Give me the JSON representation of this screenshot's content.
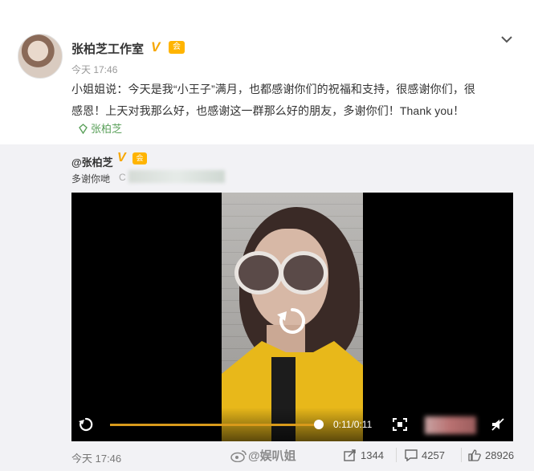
{
  "post": {
    "author": "张柏芝工作室",
    "verified_badge": "V",
    "vip_badge": "会",
    "time": "今天 17:46",
    "text_line1": "小姐姐说：今天是我“小王子”满月，也都感谢你们的祝福和支持，很感谢你们，很",
    "text_line2": "感恩！上天对我那么好，也感谢这一群那么好的朋友，多谢你们！Thank you！",
    "topic": "张柏芝"
  },
  "repost": {
    "author": "@张柏芝",
    "verified_badge": "V",
    "vip_badge": "会",
    "text": "多谢你哋",
    "link_prefix": "C"
  },
  "video": {
    "time": "0:11/0:11",
    "progress": 1.0
  },
  "footer": {
    "time": "今天 17:46",
    "watermark": "@娱叭姐",
    "reposts": "1344",
    "comments": "4257",
    "likes": "28926"
  },
  "colors": {
    "accent": "#f7a700",
    "topic": "#5aa05a",
    "progress": "#d99a1b"
  },
  "icons": [
    "chevron-down-icon",
    "topic-icon",
    "replay-icon",
    "fullscreen-icon",
    "mute-icon",
    "repost-icon",
    "comment-icon",
    "like-icon",
    "weibo-icon"
  ]
}
